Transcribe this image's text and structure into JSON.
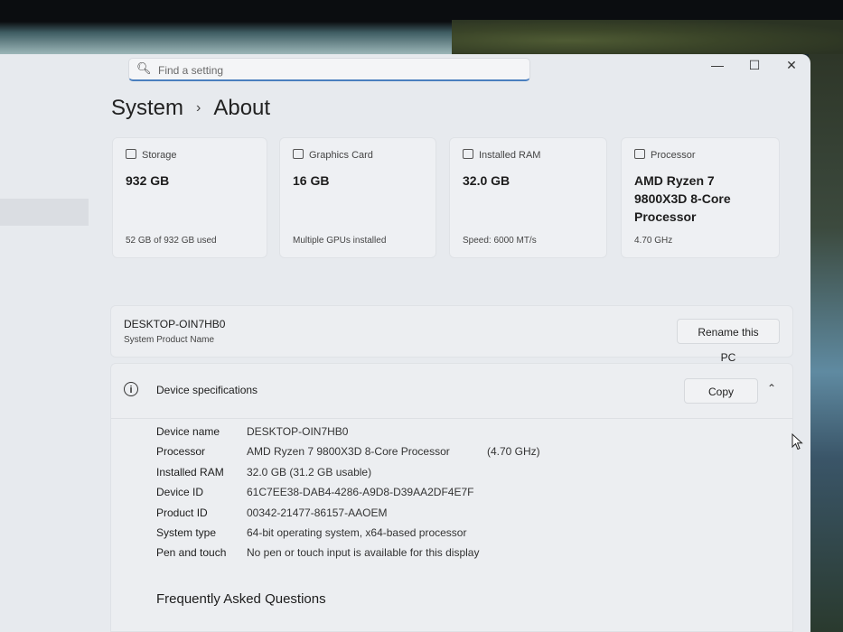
{
  "search": {
    "placeholder": "Find a setting"
  },
  "window_controls": {
    "minimize": "—",
    "maximize": "☐",
    "close": "✕"
  },
  "breadcrumb": {
    "parent": "System",
    "separator": "›",
    "current": "About"
  },
  "cards": [
    {
      "label": "Storage",
      "value": "932 GB",
      "sub": "52 GB of 932 GB used",
      "icon": "storage-icon"
    },
    {
      "label": "Graphics Card",
      "value": "16 GB",
      "sub": "Multiple GPUs installed",
      "icon": "graphics-card-icon"
    },
    {
      "label": "Installed RAM",
      "value": "32.0 GB",
      "sub": "Speed: 6000 MT/s",
      "icon": "ram-icon"
    },
    {
      "label": "Processor",
      "value": "AMD Ryzen 7 9800X3D 8-Core Processor",
      "sub": "4.70 GHz",
      "icon": "processor-icon"
    }
  ],
  "pc": {
    "name": "DESKTOP-OIN7HB0",
    "label": "System Product Name",
    "rename_button": "Rename this PC"
  },
  "device_specs": {
    "title": "Device specifications",
    "copy_button": "Copy",
    "rows": [
      {
        "label": "Device name",
        "value": "DESKTOP-OIN7HB0",
        "extra": ""
      },
      {
        "label": "Processor",
        "value": "AMD Ryzen 7 9800X3D 8-Core Processor",
        "extra": "(4.70 GHz)"
      },
      {
        "label": "Installed RAM",
        "value": "32.0 GB (31.2 GB usable)",
        "extra": ""
      },
      {
        "label": "Device ID",
        "value": "61C7EE38-DAB4-4286-A9D8-D39AA2DF4E7F",
        "extra": ""
      },
      {
        "label": "Product ID",
        "value": "00342-21477-86157-AAOEM",
        "extra": ""
      },
      {
        "label": "System type",
        "value": "64-bit operating system, x64-based processor",
        "extra": ""
      },
      {
        "label": "Pen and touch",
        "value": "No pen or touch input is available for this display",
        "extra": ""
      }
    ]
  },
  "faq": {
    "title": "Frequently Asked Questions"
  }
}
